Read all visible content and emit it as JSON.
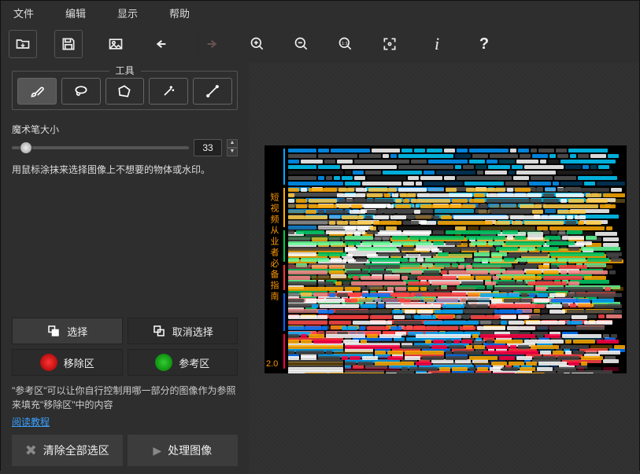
{
  "menu": {
    "file": "文件",
    "edit": "编辑",
    "view": "显示",
    "help": "帮助"
  },
  "tools_legend": "工具",
  "brush_size_label": "魔术笔大小",
  "brush_size_value": "33",
  "brush_hint": "用鼠标涂抹来选择图像上不想要的物体或水印。",
  "select_btn": "选择",
  "deselect_btn": "取消选择",
  "remove_zone": "移除区",
  "ref_zone": "参考区",
  "ref_note": "\"参考区\"可以让你自行控制用哪一部分的图像作为参照来填充\"移除区\"中的内容",
  "tutorial_link": "阅读教程",
  "clear_all": "清除全部选区",
  "process": "处理图像",
  "image_sidebar": "短视频从业者必备指南",
  "image_version": "2.0"
}
